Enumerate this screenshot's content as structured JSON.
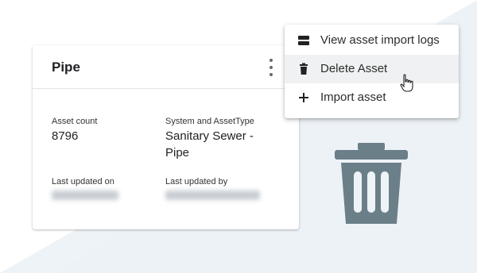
{
  "card": {
    "title": "Pipe",
    "fields": {
      "asset_count_label": "Asset count",
      "asset_count_value": "8796",
      "system_label": "System and AssetType",
      "system_value_line1": "Sanitary Sewer -",
      "system_value_line2": "Pipe",
      "last_updated_on_label": "Last updated on",
      "last_updated_by_label": "Last updated by"
    }
  },
  "menu": {
    "items": [
      {
        "label": "View asset import logs",
        "icon": "server-icon"
      },
      {
        "label": "Delete Asset",
        "icon": "trash-icon",
        "highlighted": true
      },
      {
        "label": "Import asset",
        "icon": "plus-icon"
      }
    ]
  },
  "colors": {
    "icon_slate": "#6b7f89",
    "background_tint": "#eef3f7",
    "menu_highlight": "#f0f1f2"
  }
}
